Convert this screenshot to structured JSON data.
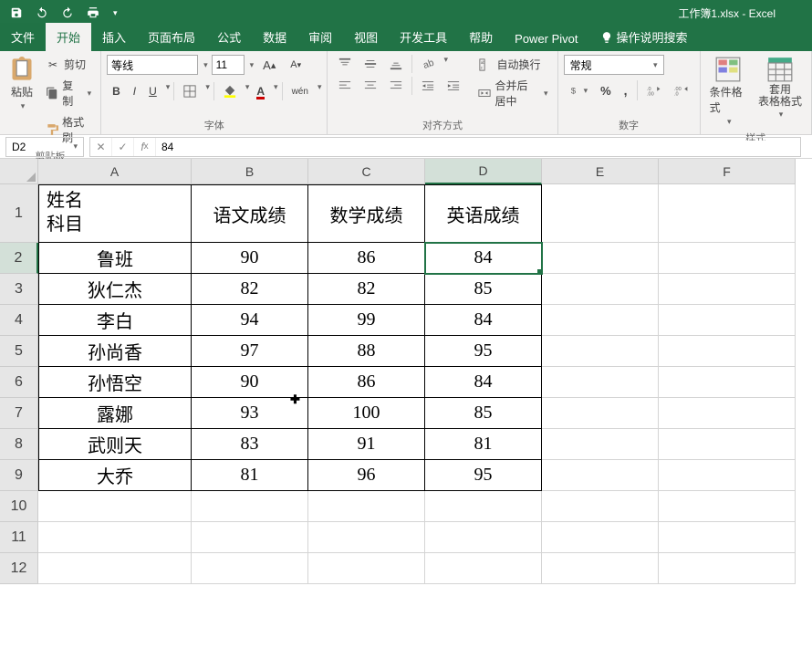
{
  "titlebar": {
    "title": "工作簿1.xlsx - Excel"
  },
  "tabs": {
    "file": "文件",
    "home": "开始",
    "insert": "插入",
    "layout": "页面布局",
    "formulas": "公式",
    "data": "数据",
    "review": "审阅",
    "view": "视图",
    "dev": "开发工具",
    "help": "帮助",
    "powerpivot": "Power Pivot",
    "tellme": "操作说明搜索"
  },
  "ribbon": {
    "clipboard": {
      "paste": "粘贴",
      "cut": "剪切",
      "copy": "复制",
      "formatpainter": "格式刷",
      "label": "剪贴板"
    },
    "font": {
      "name": "等线",
      "size": "11",
      "bold": "B",
      "italic": "I",
      "underline": "U",
      "ruby": "wén",
      "label": "字体"
    },
    "align": {
      "wrap": "自动换行",
      "merge": "合并后居中",
      "label": "对齐方式"
    },
    "number": {
      "format": "常规",
      "label": "数字"
    },
    "styles": {
      "condfmt": "条件格式",
      "tablefmt": "套用\n表格格式",
      "label": "样式"
    }
  },
  "formulabar": {
    "namebox": "D2",
    "value": "84"
  },
  "grid": {
    "cols": [
      "A",
      "B",
      "C",
      "D",
      "E",
      "F"
    ],
    "rows": [
      "1",
      "2",
      "3",
      "4",
      "5",
      "6",
      "7",
      "8",
      "9",
      "10",
      "11",
      "12"
    ],
    "header": {
      "a_line1": "姓名",
      "a_line2": "科目",
      "b": "语文成绩",
      "c": "数学成绩",
      "d": "英语成绩"
    },
    "data": [
      {
        "name": "鲁班",
        "b": "90",
        "c": "86",
        "d": "84"
      },
      {
        "name": "狄仁杰",
        "b": "82",
        "c": "82",
        "d": "85"
      },
      {
        "name": "李白",
        "b": "94",
        "c": "99",
        "d": "84"
      },
      {
        "name": "孙尚香",
        "b": "97",
        "c": "88",
        "d": "95"
      },
      {
        "name": "孙悟空",
        "b": "90",
        "c": "86",
        "d": "84"
      },
      {
        "name": "露娜",
        "b": "93",
        "c": "100",
        "d": "85"
      },
      {
        "name": "武则天",
        "b": "83",
        "c": "91",
        "d": "81"
      },
      {
        "name": "大乔",
        "b": "81",
        "c": "96",
        "d": "95"
      }
    ],
    "selected": {
      "col": "D",
      "row": 2
    }
  }
}
